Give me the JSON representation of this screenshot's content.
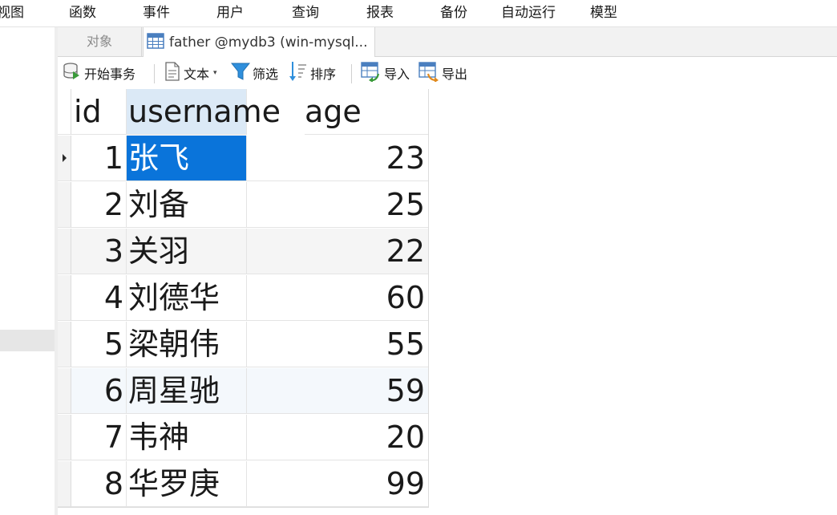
{
  "menu": {
    "items": [
      "视图",
      "函数",
      "事件",
      "用户",
      "查询",
      "报表",
      "备份",
      "自动运行",
      "模型"
    ]
  },
  "tabs": {
    "objects": "对象",
    "active": "father @mydb3 (win-mysql..."
  },
  "toolbar": {
    "begin_transaction": "开始事务",
    "text": "文本",
    "filter": "筛选",
    "sort": "排序",
    "import": "导入",
    "export": "导出"
  },
  "grid": {
    "columns": [
      "id",
      "username",
      "age"
    ],
    "rows": [
      {
        "id": "1",
        "username": "张飞",
        "age": "23"
      },
      {
        "id": "2",
        "username": "刘备",
        "age": "25"
      },
      {
        "id": "3",
        "username": "关羽",
        "age": "22"
      },
      {
        "id": "4",
        "username": "刘德华",
        "age": "60"
      },
      {
        "id": "5",
        "username": "梁朝伟",
        "age": "55"
      },
      {
        "id": "6",
        "username": "周星驰",
        "age": "59"
      },
      {
        "id": "7",
        "username": "韦神",
        "age": "20"
      },
      {
        "id": "8",
        "username": "华罗庚",
        "age": "99"
      }
    ],
    "selected_row": 0
  },
  "colors": {
    "selection": "#0a74da",
    "header_highlight": "#dbe9f6"
  },
  "icons": {
    "begin_transaction": "database-transaction-icon",
    "text": "document-text-icon",
    "filter": "funnel-filter-icon",
    "sort": "sort-list-icon",
    "import": "table-import-icon",
    "export": "table-export-icon",
    "tab": "table-grid-icon"
  }
}
